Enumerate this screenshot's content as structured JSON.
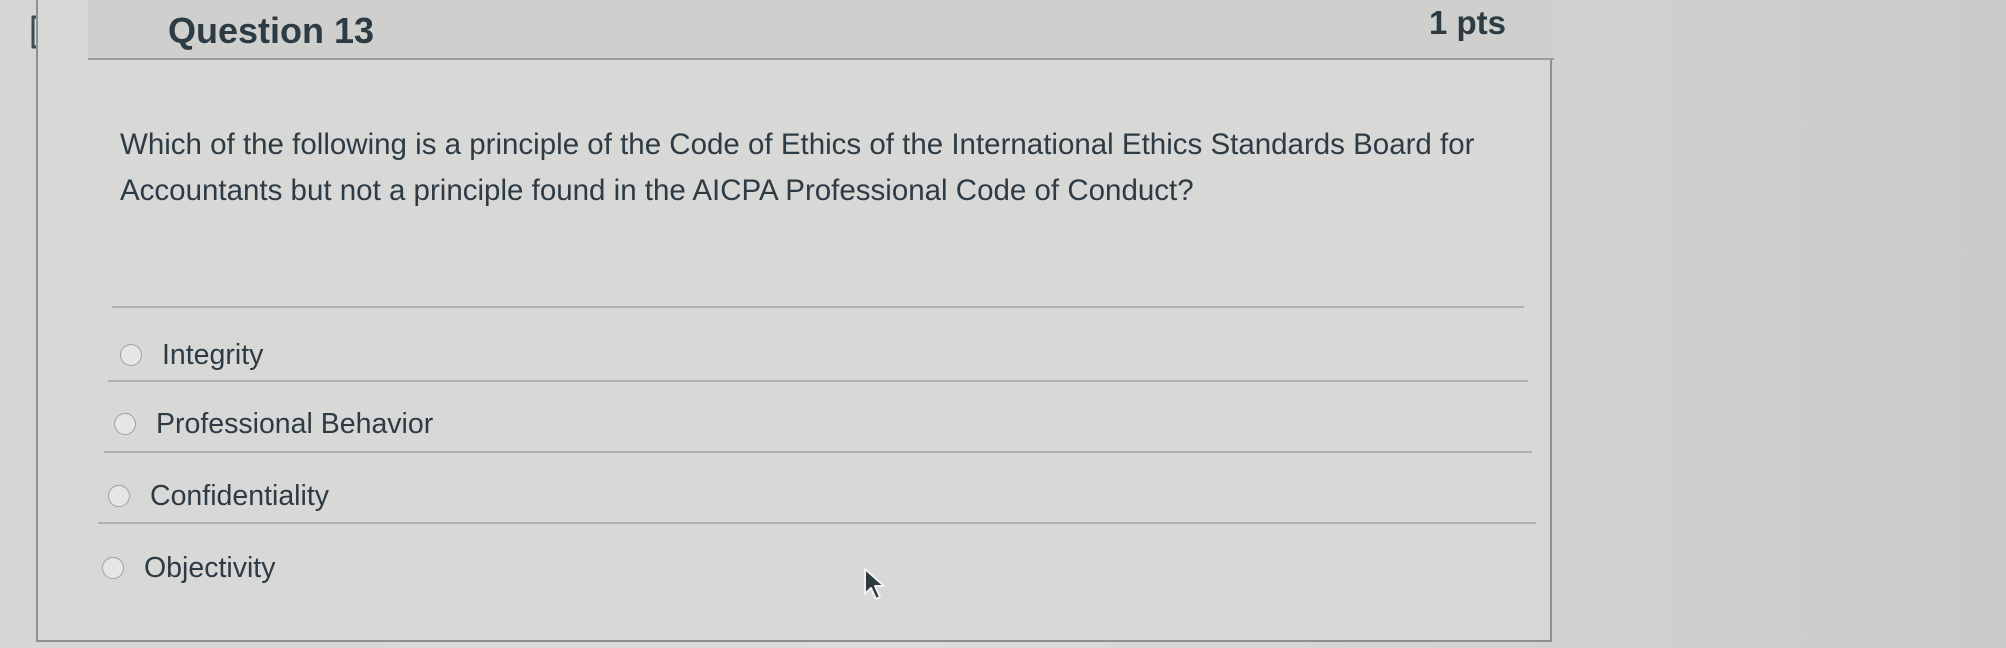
{
  "question": {
    "title": "Question 13",
    "points": "1 pts",
    "text": "Which of the following is a principle of the Code of Ethics of the International Ethics Standards Board for Accountants but not a principle found in the AICPA Professional Code of Conduct?",
    "flag_icon": "flag-icon"
  },
  "answers": [
    {
      "label": "Integrity",
      "selected": false
    },
    {
      "label": "Professional Behavior",
      "selected": false
    },
    {
      "label": "Confidentiality",
      "selected": false
    },
    {
      "label": "Objectivity",
      "selected": false
    }
  ],
  "colors": {
    "text": "#2d3b45",
    "background": "#d8d8d6",
    "header": "#cfcfcd",
    "border": "#8d8f90"
  }
}
